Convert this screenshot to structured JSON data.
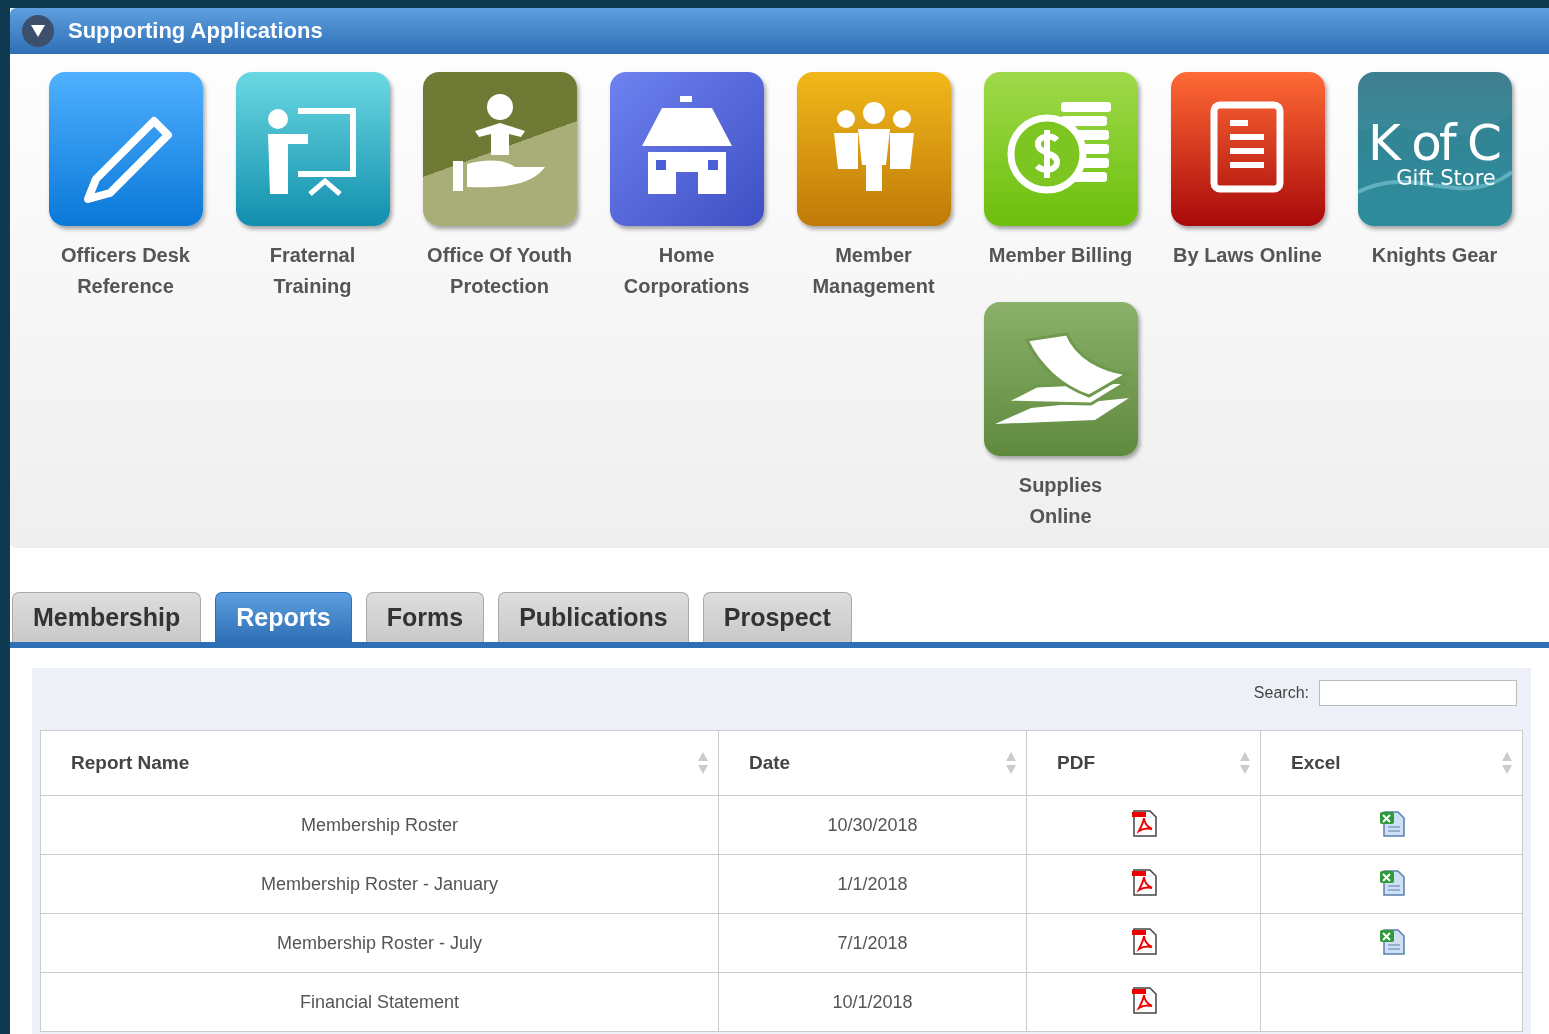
{
  "panel": {
    "title": "Supporting Applications",
    "expanded": true
  },
  "apps": [
    {
      "label": "Officers Desk Reference",
      "kind": "pencil"
    },
    {
      "label": "Fraternal Training",
      "kind": "teacher"
    },
    {
      "label": "Office Of Youth Protection",
      "kind": "hand"
    },
    {
      "label": "Home Corporations",
      "kind": "house"
    },
    {
      "label": "Member Management",
      "kind": "people"
    },
    {
      "label": "Member Billing",
      "kind": "coins"
    },
    {
      "label": "By Laws Online",
      "kind": "document"
    },
    {
      "label": "Knights Gear",
      "kind": "logo",
      "logo_text": [
        "K of C",
        "Gift Store"
      ]
    },
    {
      "label": "Supplies Online",
      "kind": "papers"
    }
  ],
  "tabs": [
    {
      "label": "Membership",
      "selected": false
    },
    {
      "label": "Reports",
      "selected": true
    },
    {
      "label": "Forms",
      "selected": false
    },
    {
      "label": "Publications",
      "selected": false
    },
    {
      "label": "Prospect",
      "selected": false
    }
  ],
  "search": {
    "label": "Search:"
  },
  "table": {
    "columns": [
      "Report Name",
      "Date",
      "PDF",
      "Excel"
    ],
    "rows": [
      {
        "name": "Membership Roster",
        "date": "10/30/2018",
        "pdf": true,
        "excel": true
      },
      {
        "name": "Membership Roster - January",
        "date": "1/1/2018",
        "pdf": true,
        "excel": true
      },
      {
        "name": "Membership Roster - July",
        "date": "7/1/2018",
        "pdf": true,
        "excel": true
      },
      {
        "name": "Financial Statement",
        "date": "10/1/2018",
        "pdf": true,
        "excel": false
      }
    ]
  }
}
